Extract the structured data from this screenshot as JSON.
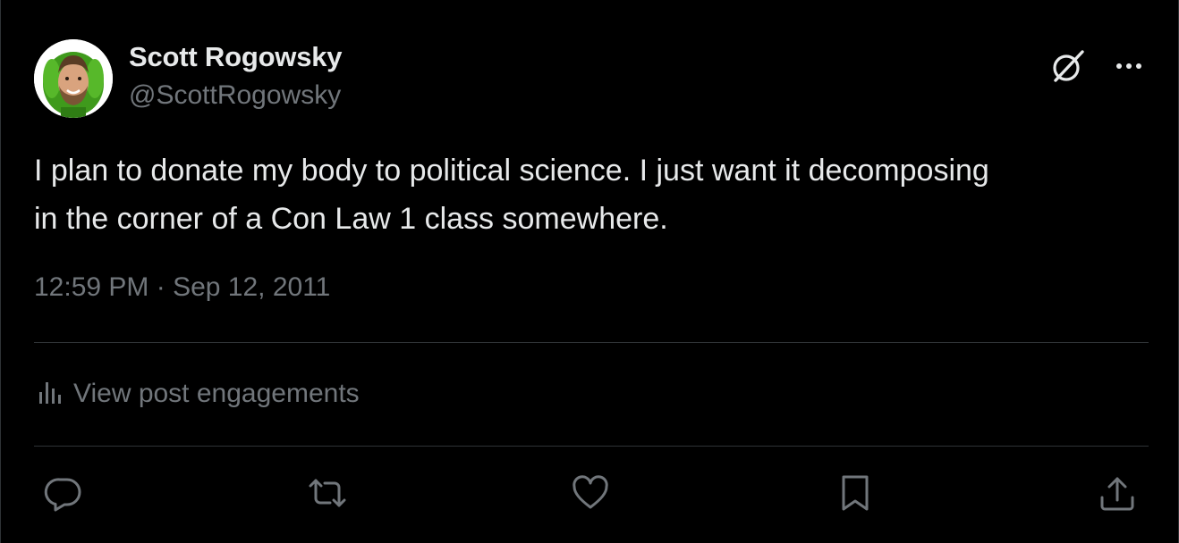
{
  "author": {
    "display_name": "Scott Rogowsky",
    "handle": "@ScottRogowsky"
  },
  "post": {
    "text": "I plan to donate my body to political science. I just want it decomposing\nin the corner of a Con Law 1 class somewhere.",
    "timestamp": "12:59 PM · Sep 12, 2011"
  },
  "engagements": {
    "label": "View post engagements"
  },
  "icons": {
    "grok": "grok-icon",
    "more": "more-icon",
    "analytics": "analytics-icon",
    "reply": "reply-icon",
    "repost": "repost-icon",
    "like": "like-icon",
    "bookmark": "bookmark-icon",
    "share": "share-icon"
  },
  "colors": {
    "background": "#000000",
    "primary_text": "#e7e9ea",
    "secondary_text": "#71767b",
    "divider": "#2f3336"
  }
}
